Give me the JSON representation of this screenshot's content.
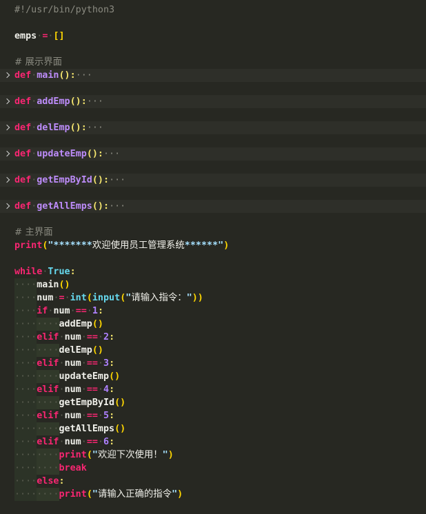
{
  "editor": {
    "lines": {
      "l0": {
        "text": "#!/usr/bin/python3"
      },
      "l1": {
        "var": "emps",
        "op": "=",
        "val": "[]"
      },
      "l2": {
        "text": "# 展示界面"
      },
      "l3": {
        "kw": "def",
        "name": "main",
        "tail": "():",
        "ellipsis": "···"
      },
      "l4": {
        "kw": "def",
        "name": "addEmp",
        "tail": "():",
        "ellipsis": "···"
      },
      "l5": {
        "kw": "def",
        "name": "delEmp",
        "tail": "():",
        "ellipsis": "···"
      },
      "l6": {
        "kw": "def",
        "name": "updateEmp",
        "tail": "():",
        "ellipsis": "···"
      },
      "l7": {
        "kw": "def",
        "name": "getEmpById",
        "tail": "():",
        "ellipsis": "···"
      },
      "l8": {
        "kw": "def",
        "name": "getAllEmps",
        "tail": "():",
        "ellipsis": "···"
      },
      "l9": {
        "text": "# 主界面"
      },
      "l10": {
        "fn": "print",
        "open": "(",
        "str_open": "\"*******",
        "str_text": "欢迎使用员工管理系统",
        "str_close": "******\"",
        "close": ")"
      },
      "l11": {
        "kw": "while",
        "val": "True",
        "colon": ":"
      },
      "l12": {
        "call": "main",
        "paren": "()"
      },
      "l13": {
        "var": "num",
        "op": "=",
        "fn1": "int",
        "fn2": "input",
        "str_text": "请输入指令：",
        "close": "))"
      },
      "l14": {
        "kw": "if",
        "var": "num",
        "op": "==",
        "num": "1",
        "colon": ":"
      },
      "l15": {
        "call": "addEmp",
        "paren": "()"
      },
      "l16": {
        "kw": "elif",
        "var": "num",
        "op": "==",
        "num": "2",
        "colon": ":"
      },
      "l17": {
        "call": "delEmp",
        "paren": "()"
      },
      "l18": {
        "kw": "elif",
        "var": "num",
        "op": "==",
        "num": "3",
        "colon": ":"
      },
      "l19": {
        "call": "updateEmp",
        "paren": "()"
      },
      "l20": {
        "kw": "elif",
        "var": "num",
        "op": "==",
        "num": "4",
        "colon": ":"
      },
      "l21": {
        "call": "getEmpById",
        "paren": "()"
      },
      "l22": {
        "kw": "elif",
        "var": "num",
        "op": "==",
        "num": "5",
        "colon": ":"
      },
      "l23": {
        "call": "getAllEmps",
        "paren": "()"
      },
      "l24": {
        "kw": "elif",
        "var": "num",
        "op": "==",
        "num": "6",
        "colon": ":"
      },
      "l25": {
        "fn": "print",
        "str_text": "欢迎下次使用！"
      },
      "l26": {
        "kw": "break"
      },
      "l27": {
        "kw": "else",
        "colon": ":"
      },
      "l28": {
        "fn": "print",
        "str_text": "请输入正确的指令"
      }
    }
  },
  "colors": {
    "background": "#272822",
    "keyword": "#f92672",
    "function_name": "#bd8cfa",
    "builtin": "#66d9ef",
    "number": "#ae81ff",
    "comment": "#8a8a80",
    "string_quote": "#e6db74"
  }
}
